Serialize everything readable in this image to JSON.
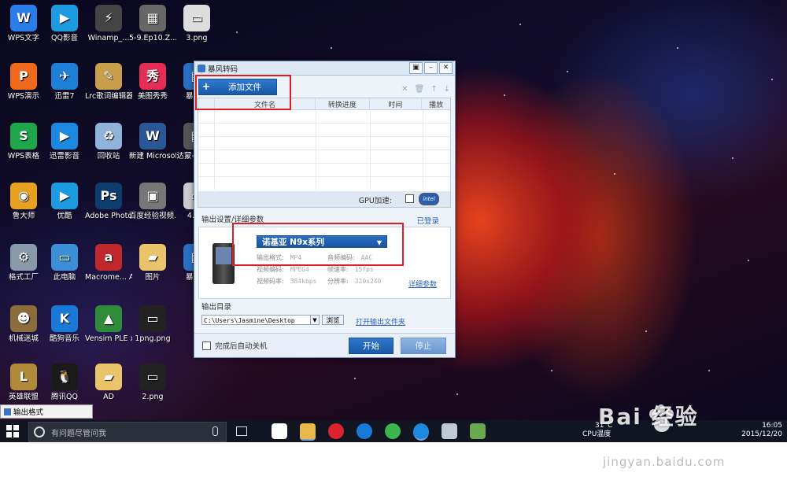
{
  "desktop": {
    "icons": [
      {
        "label": "WPS文字",
        "icon": "wps-writer-icon",
        "color": "#2b7de9",
        "glyph": "W",
        "col": 0,
        "row": 0
      },
      {
        "label": "QQ影音",
        "icon": "qq-player-icon",
        "color": "#1d9be0",
        "glyph": "▶",
        "col": 1,
        "row": 0
      },
      {
        "label": "Winamp_...",
        "icon": "winamp-icon",
        "color": "#444444",
        "glyph": "⚡",
        "col": 2,
        "row": 0
      },
      {
        "label": "5-9.Ep10.Z...",
        "icon": "video-file-icon",
        "color": "#666666",
        "glyph": "▦",
        "col": 3,
        "row": 0
      },
      {
        "label": "3.png",
        "icon": "png-file-icon",
        "color": "#dddddd",
        "glyph": "▭",
        "col": 4,
        "row": 0
      },
      {
        "label": "WPS演示",
        "icon": "wps-presentation-icon",
        "color": "#ef6a1d",
        "glyph": "P",
        "col": 0,
        "row": 1
      },
      {
        "label": "迅雷7",
        "icon": "xunlei-icon",
        "color": "#1d7fd6",
        "glyph": "✈",
        "col": 1,
        "row": 1
      },
      {
        "label": "Lrc歌词编辑器",
        "icon": "lrc-editor-icon",
        "color": "#c89e4a",
        "glyph": "✎",
        "col": 2,
        "row": 1
      },
      {
        "label": "美图秀秀",
        "icon": "meitu-icon",
        "color": "#e42c54",
        "glyph": "秀",
        "col": 3,
        "row": 1
      },
      {
        "label": "暴风...",
        "icon": "baofeng-icon",
        "color": "#2a6fc2",
        "glyph": "▤",
        "col": 4,
        "row": 1
      },
      {
        "label": "WPS表格",
        "icon": "wps-spreadsheet-icon",
        "color": "#1fa64a",
        "glyph": "S",
        "col": 0,
        "row": 2
      },
      {
        "label": "迅雷影音",
        "icon": "xunlei-player-icon",
        "color": "#1d88e0",
        "glyph": "▶",
        "col": 1,
        "row": 2
      },
      {
        "label": "回收站",
        "icon": "recycle-bin-icon",
        "color": "#8fb3d9",
        "glyph": "♻",
        "col": 2,
        "row": 2
      },
      {
        "label": "新建 Microsof...",
        "icon": "word-doc-icon",
        "color": "#2b5797",
        "glyph": "W",
        "col": 3,
        "row": 2
      },
      {
        "label": "达蒙-托的刹",
        "icon": "video-file-icon",
        "color": "#555555",
        "glyph": "▦",
        "col": 4,
        "row": 2
      },
      {
        "label": "鲁大师",
        "icon": "ludashi-icon",
        "color": "#e8a020",
        "glyph": "◉",
        "col": 0,
        "row": 3
      },
      {
        "label": "优酷",
        "icon": "youku-icon",
        "color": "#1d9be0",
        "glyph": "▶",
        "col": 1,
        "row": 3
      },
      {
        "label": "Adobe Photosh...",
        "icon": "photoshop-icon",
        "color": "#0d3c6e",
        "glyph": "Ps",
        "col": 2,
        "row": 3
      },
      {
        "label": "百度经验视频.exe",
        "icon": "exe-file-icon",
        "color": "#777777",
        "glyph": "▣",
        "col": 3,
        "row": 3
      },
      {
        "label": "4.p...",
        "icon": "png-file-icon",
        "color": "#cccccc",
        "glyph": "▭",
        "col": 4,
        "row": 3
      },
      {
        "label": "格式工厂",
        "icon": "format-factory-icon",
        "color": "#8899aa",
        "glyph": "⚙",
        "col": 0,
        "row": 4
      },
      {
        "label": "此电脑",
        "icon": "this-pc-icon",
        "color": "#3b8fd8",
        "glyph": "▭",
        "col": 1,
        "row": 4
      },
      {
        "label": "Macrome... Authorwa...",
        "icon": "macromedia-icon",
        "color": "#c0282c",
        "glyph": "a",
        "col": 2,
        "row": 4
      },
      {
        "label": "图片",
        "icon": "folder-icon",
        "color": "#e9c46a",
        "glyph": "▰",
        "col": 3,
        "row": 4
      },
      {
        "label": "暴风...",
        "icon": "baofeng-icon",
        "color": "#2a6fc2",
        "glyph": "▤",
        "col": 4,
        "row": 4
      },
      {
        "label": "机械迷城",
        "icon": "machinarium-icon",
        "color": "#8a6d3b",
        "glyph": "☻",
        "col": 0,
        "row": 5
      },
      {
        "label": "酷狗音乐",
        "icon": "kugou-icon",
        "color": "#1979d8",
        "glyph": "K",
        "col": 1,
        "row": 5
      },
      {
        "label": "Vensim PLE x32",
        "icon": "vensim-icon",
        "color": "#2f8a3a",
        "glyph": "▲",
        "col": 2,
        "row": 5
      },
      {
        "label": "1png.png",
        "icon": "png-file-icon",
        "color": "#222222",
        "glyph": "▭",
        "col": 3,
        "row": 5
      },
      {
        "label": "英雄联盟",
        "icon": "lol-icon",
        "color": "#b08a3a",
        "glyph": "L",
        "col": 0,
        "row": 6
      },
      {
        "label": "腾讯QQ",
        "icon": "qq-icon",
        "color": "#1a1a1a",
        "glyph": "🐧",
        "col": 1,
        "row": 6
      },
      {
        "label": "AD",
        "icon": "folder-icon",
        "color": "#e9c46a",
        "glyph": "▰",
        "col": 2,
        "row": 6
      },
      {
        "label": "2.png",
        "icon": "png-file-icon",
        "color": "#222222",
        "glyph": "▭",
        "col": 3,
        "row": 6
      }
    ]
  },
  "window": {
    "title": "暴风转码",
    "add_file_label": "添加文件",
    "columns": [
      "文件名",
      "转换进度",
      "时间",
      "播放"
    ],
    "gpu_label": "GPU加速:",
    "intel_badge": "intel",
    "output_settings_label": "输出设置/详细参数",
    "login_label": "已登录",
    "device_label": "诺基亚 N9x系列",
    "params": [
      {
        "label": "输出格式:",
        "value": "MP4"
      },
      {
        "label": "音频编码:",
        "value": "AAC"
      },
      {
        "label": "视频编码:",
        "value": "MPEG4"
      },
      {
        "label": "帧速率:",
        "value": "15fps"
      },
      {
        "label": "视频码率:",
        "value": "384kbps"
      },
      {
        "label": "分辨率:",
        "value": "320x240"
      }
    ],
    "detail_params_label": "详细参数",
    "output_dir_label": "输出目录",
    "output_dir_value": "C:\\Users\\Jasmine\\Desktop",
    "browse_label": "浏览",
    "open_folder_label": "打开输出文件夹",
    "auto_shutdown_label": "完成后自动关机",
    "start_label": "开始",
    "stop_label": "停止"
  },
  "taskbar_tooltip": "输出格式",
  "taskbar": {
    "search_placeholder": "有问题尽管问我",
    "temp": "31°C",
    "cpu": "CPU温度",
    "time": "16:05",
    "date": "2015/12/20"
  },
  "watermark": {
    "brand": "Bai 经验",
    "url": "jingyan.baidu.com"
  }
}
